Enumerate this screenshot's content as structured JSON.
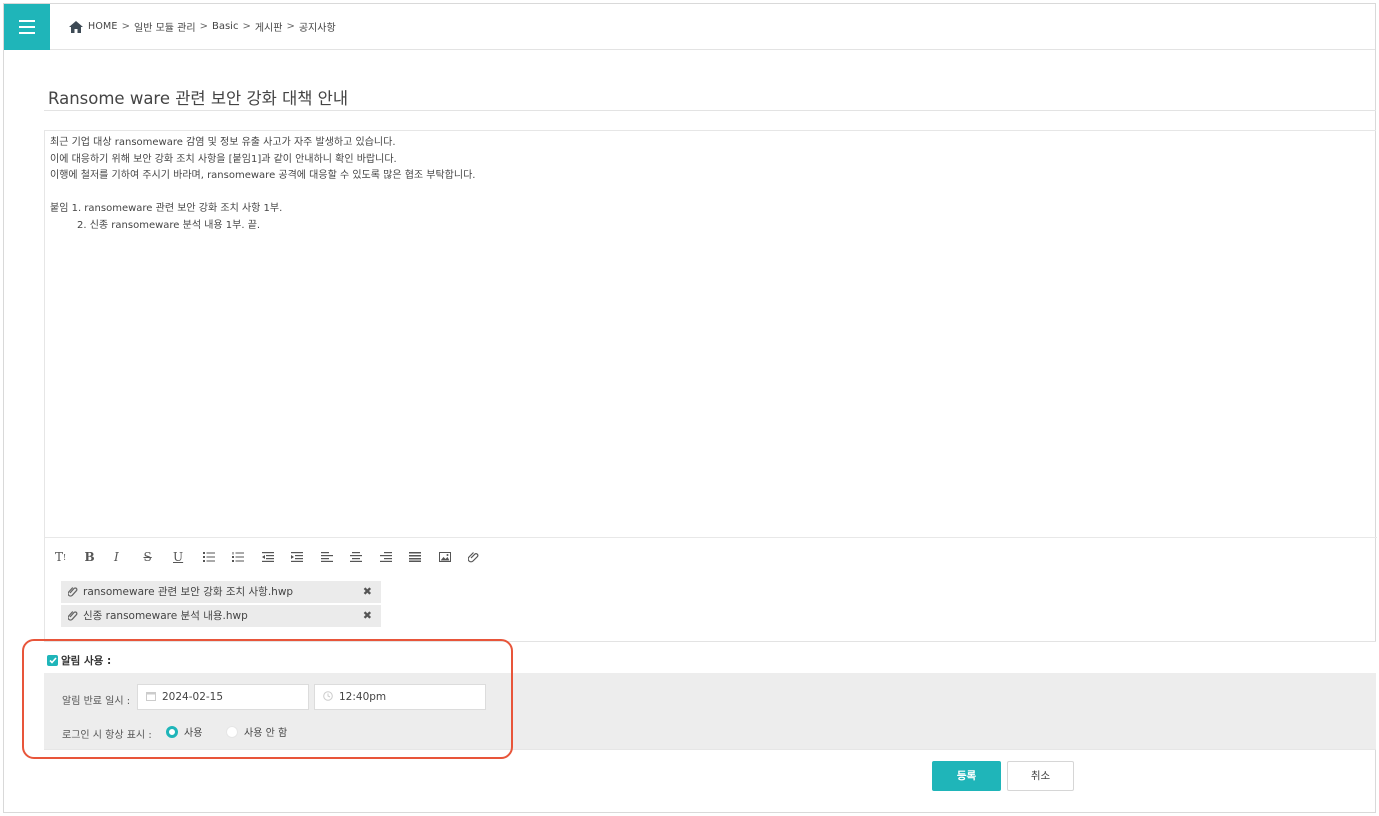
{
  "breadcrumb": {
    "home": "HOME",
    "separator": ">",
    "items": [
      "일반 모듈 관리",
      "Basic",
      "게시판",
      "공지사항"
    ]
  },
  "post": {
    "title": "Ransome ware 관련 보안 강화 대책 안내",
    "body_lines": [
      "최근 기업 대상 ransomeware 감염 및 정보 유출 사고가 자주 발생하고 있습니다.",
      "이에 대응하기 위해 보안 강화 조치 사항을 [붙임1]과 같이 안내하니 확인 바랍니다.",
      "이행에 철저를 기하여 주시기 바라며, ransomeware 공격에 대응할 수 있도록 많은 협조 부탁합니다."
    ],
    "attachment_lines": [
      "붙임  1. ransomeware 관련 보안 강화 조치 사항 1부.",
      "2. 신종 ransomeware 분석 내용 1부. 끝."
    ]
  },
  "toolbar": {
    "icons": [
      "text-size-icon",
      "bold-icon",
      "italic-icon",
      "strikethrough-icon",
      "underline-icon",
      "bullet-list-icon",
      "numbered-list-icon",
      "outdent-icon",
      "indent-icon",
      "align-left-icon",
      "align-center-icon",
      "align-right-icon",
      "align-justify-icon",
      "image-icon",
      "attach-icon"
    ],
    "labels": {
      "text_size": "T",
      "bold": "B",
      "italic": "I",
      "strike": "S",
      "underline": "U"
    }
  },
  "files": [
    {
      "name": "ransomeware 관련 보안 강화 조치 사항.hwp",
      "remove": "✖"
    },
    {
      "name": "신종 ransomeware 분석 내용.hwp",
      "remove": "✖"
    }
  ],
  "alarm": {
    "enabled_label": "알림 사용 :",
    "end_label": "알림 반료 일시 :",
    "end_date": "2024-02-15",
    "end_time": "12:40pm",
    "login_label": "로그인 시 항상 표시 :",
    "option_use": "사용",
    "option_not_use": "사용 안 함",
    "selected": "사용"
  },
  "buttons": {
    "submit": "등록",
    "cancel": "취소"
  },
  "colors": {
    "accent": "#1fb5b9",
    "highlight": "#e8553a"
  }
}
